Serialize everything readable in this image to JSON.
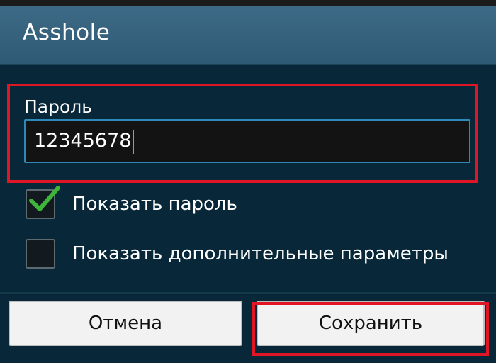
{
  "dialog": {
    "title": "Asshole"
  },
  "password": {
    "label": "Пароль",
    "value": "12345678"
  },
  "options": {
    "show_password": {
      "label": "Показать пароль",
      "checked": true
    },
    "show_advanced": {
      "label": "Показать дополнительные параметры",
      "checked": false
    }
  },
  "buttons": {
    "cancel_label": "Отмена",
    "save_label": "Сохранить"
  },
  "colors": {
    "highlight": "#e01525",
    "check": "#3fb43a",
    "accent": "#2c89b8"
  }
}
